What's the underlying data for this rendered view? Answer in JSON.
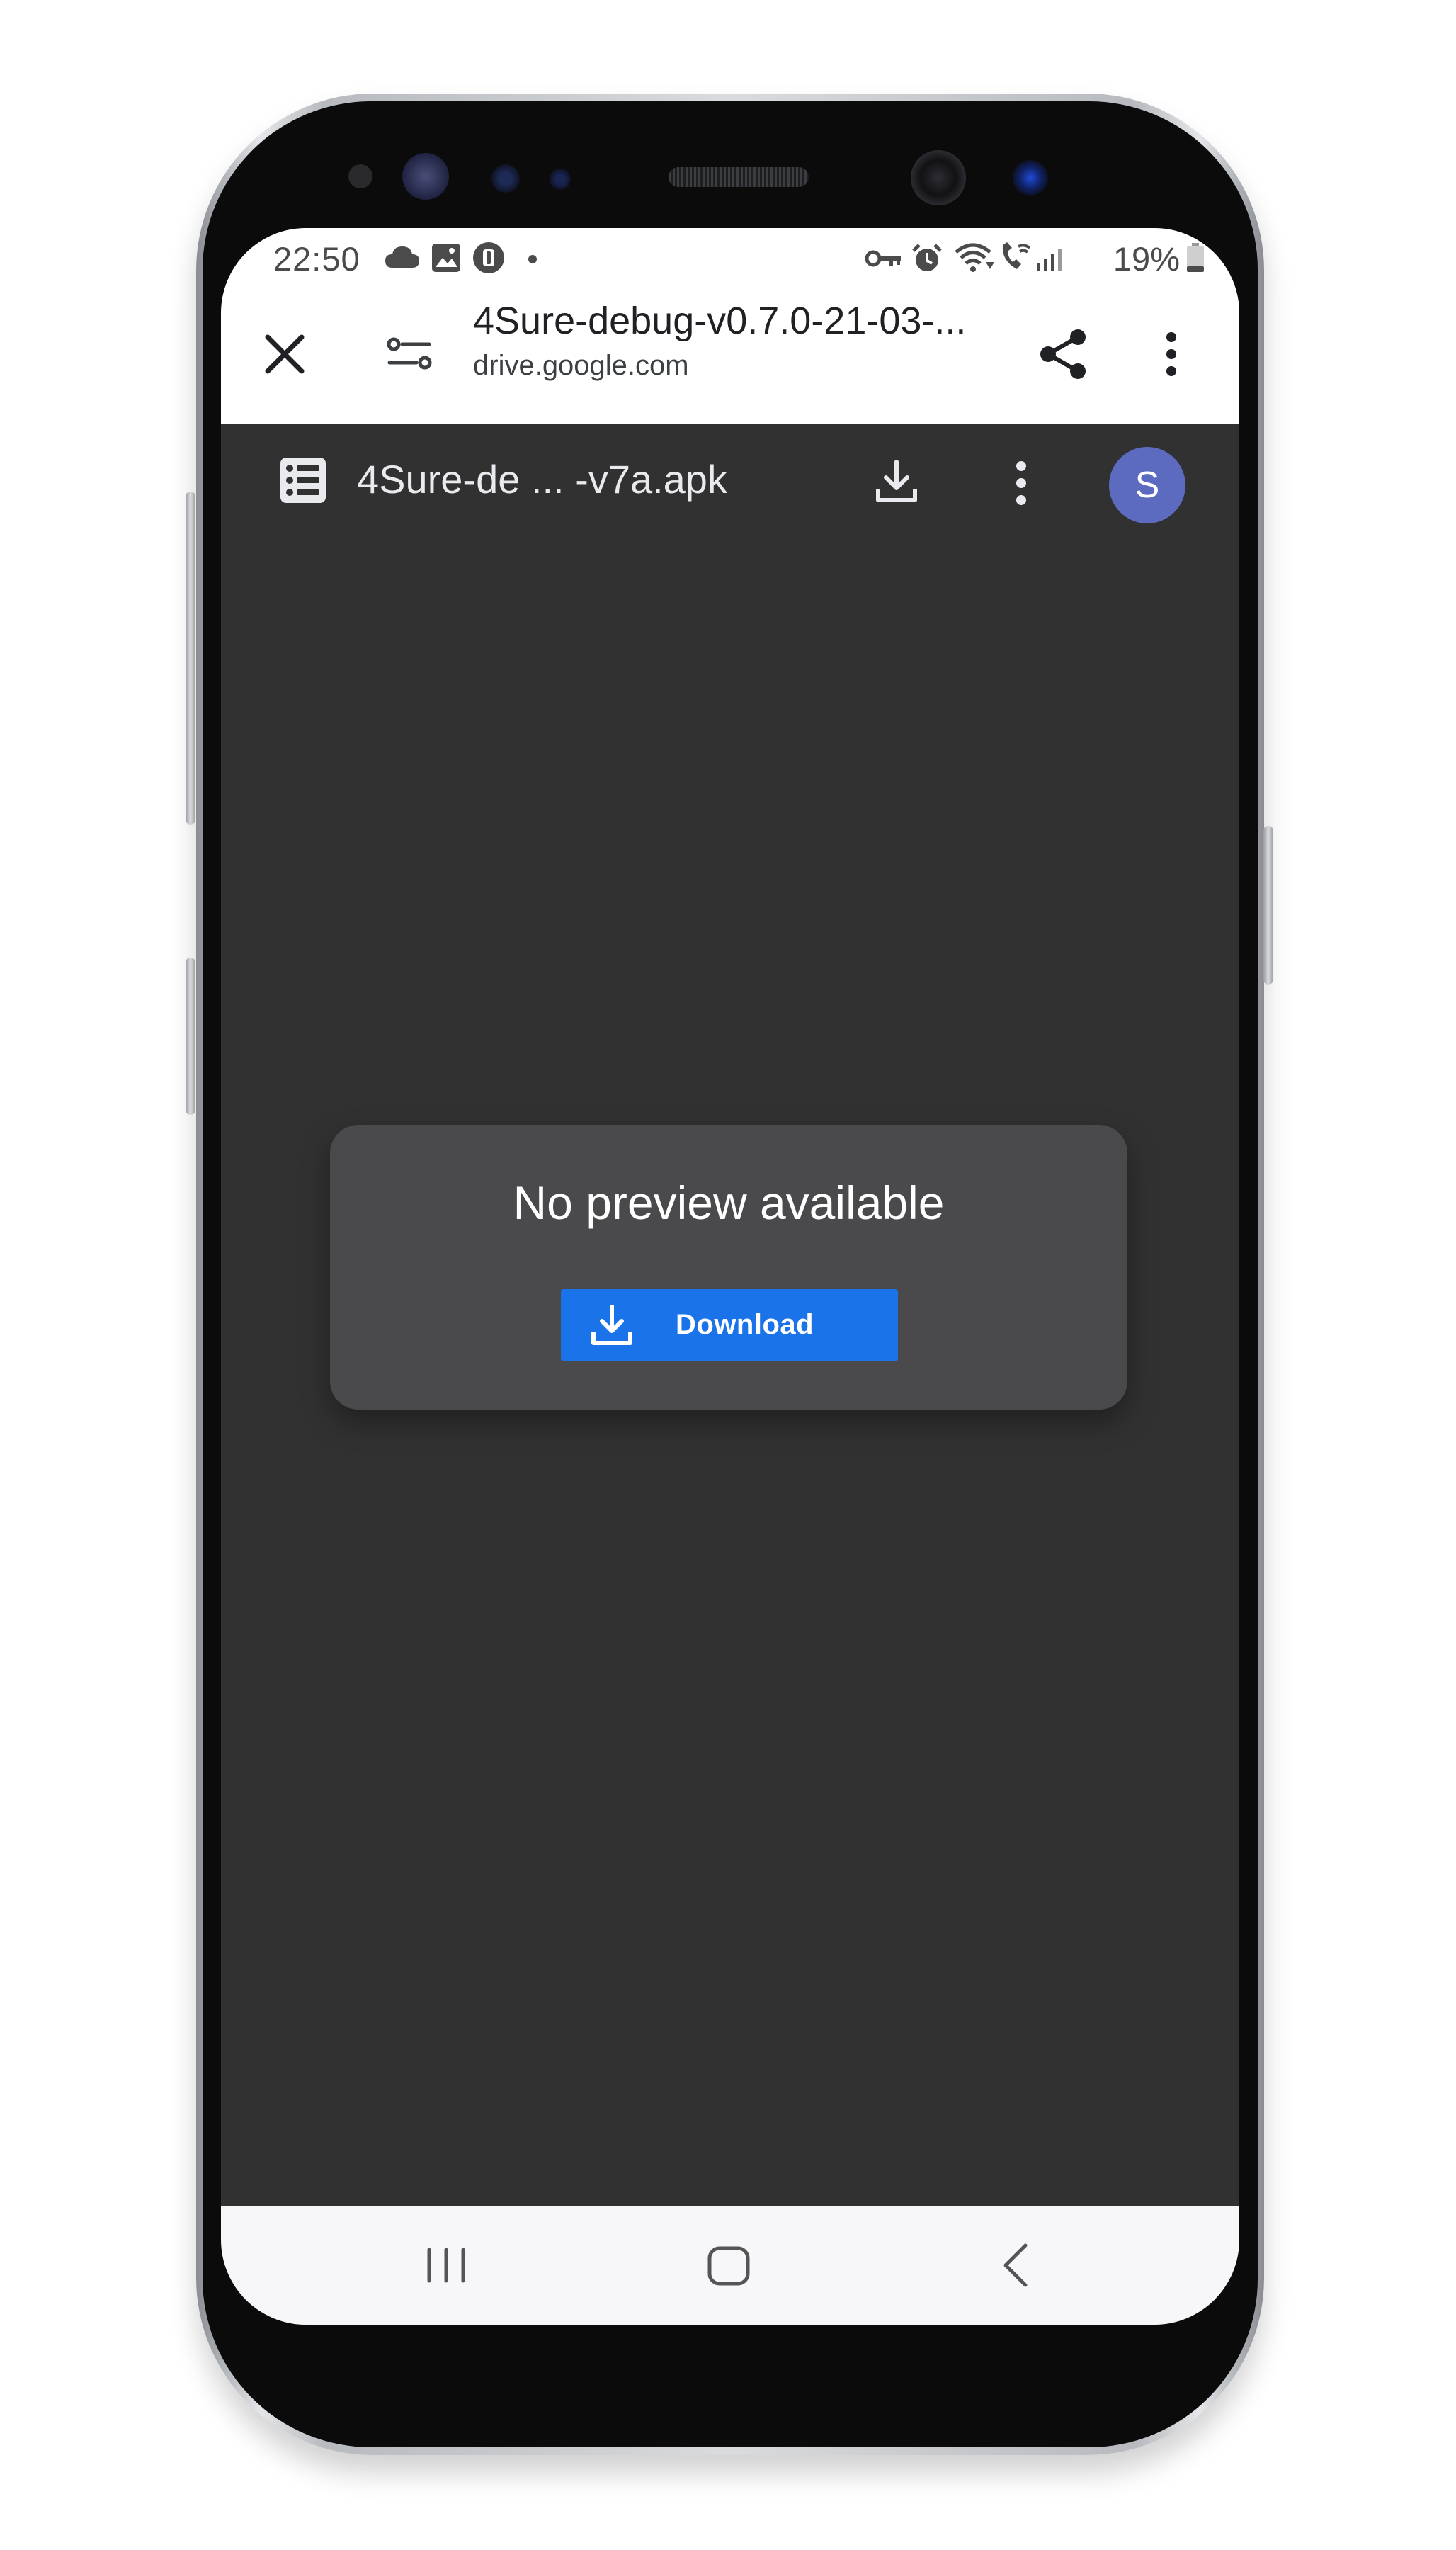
{
  "status_bar": {
    "time": "22:50",
    "battery_percent": "19%",
    "left_icons": [
      "cloud-icon",
      "gallery-icon",
      "app-notification-icon",
      "dot-icon"
    ],
    "right_icons": [
      "vpn-key-icon",
      "alarm-icon",
      "wifi-icon",
      "wifi-calling-icon",
      "signal-icon",
      "battery-icon"
    ]
  },
  "browser_bar": {
    "title": "4Sure-debug-v0.7.0-21-03-...",
    "url": "drive.google.com",
    "close_icon": "close-icon",
    "site_settings_icon": "tune-icon",
    "share_icon": "share-icon",
    "menu_icon": "more-vert-icon"
  },
  "drive_bar": {
    "file_name": "4Sure-de ... -v7a.apk",
    "file_icon": "list-icon",
    "download_icon": "download-icon",
    "menu_icon": "more-vert-icon",
    "avatar_letter": "S",
    "avatar_color": "#5c6bc0"
  },
  "preview": {
    "message": "No preview available",
    "download_label": "Download",
    "button_color": "#1a73e8"
  },
  "nav_bar": {
    "icons": [
      "recents-icon",
      "home-icon",
      "back-icon"
    ]
  },
  "colors": {
    "viewer_background": "#313131",
    "card_background": "#4a494c"
  }
}
